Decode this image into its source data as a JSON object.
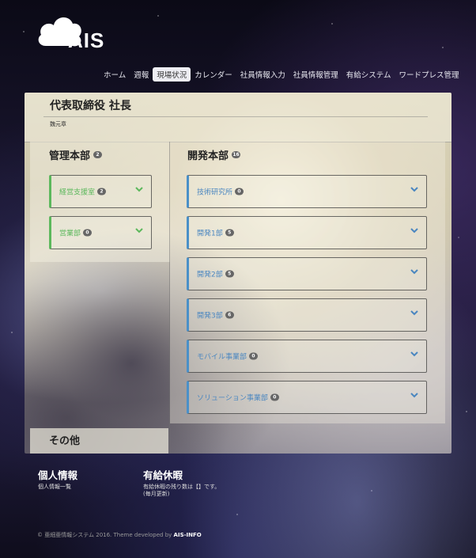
{
  "logo": {
    "text": "AIS"
  },
  "nav": [
    {
      "label": "ホーム",
      "active": false
    },
    {
      "label": "週報",
      "active": false
    },
    {
      "label": "現場状況",
      "active": true
    },
    {
      "label": "カレンダー",
      "active": false
    },
    {
      "label": "社員情報入力",
      "active": false
    },
    {
      "label": "社員情報管理",
      "active": false
    },
    {
      "label": "有給システム",
      "active": false
    },
    {
      "label": "ワードプレス管理",
      "active": false
    }
  ],
  "panel": {
    "title": "代表取締役 社長",
    "name": "魏元章",
    "left_section": {
      "title": "管理本部",
      "count": "2",
      "cards": [
        {
          "label": "経営支援室",
          "count": "2"
        },
        {
          "label": "営業部",
          "count": "0"
        }
      ]
    },
    "right_section": {
      "title": "開発本部",
      "count": "16",
      "cards": [
        {
          "label": "技術研究所",
          "count": "0"
        },
        {
          "label": "開発1部",
          "count": "5"
        },
        {
          "label": "開発2部",
          "count": "5"
        },
        {
          "label": "開発3部",
          "count": "6"
        },
        {
          "label": "モバイル事業部",
          "count": "0"
        },
        {
          "label": "ソリューション事業部",
          "count": "0"
        }
      ]
    },
    "other_label": "その他"
  },
  "footer": {
    "personal_title": "個人情報",
    "personal_link": "個人情報一覧",
    "leave_title": "有給休暇",
    "leave_text_1": "有給休暇の残り数は【】です。",
    "leave_text_2": "(毎月更新)",
    "copyright_prefix": "© 亜細亜情報システム 2016. Theme developed by",
    "copyright_brand": "AIS-INFO"
  },
  "colors": {
    "green": "#5cb85c",
    "blue": "#4a86c0"
  }
}
